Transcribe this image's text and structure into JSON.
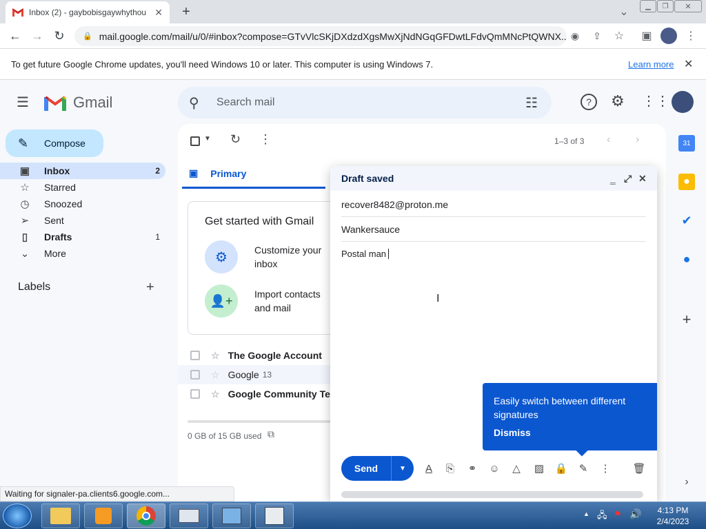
{
  "browser": {
    "tab_title": "Inbox (2) - gaybobisgaywhythou",
    "url": "mail.google.com/mail/u/0/#inbox?compose=GTvVlcSKjDXdzdXgsMwXjNdNGqGFDwtLFdvQmMNcPtQWNX...",
    "info_text": "To get future Google Chrome updates, you'll need Windows 10 or later. This computer is using Windows 7.",
    "learn_more": "Learn more",
    "status_text": "Waiting for signaler-pa.clients6.google.com..."
  },
  "gmail": {
    "logo_text": "Gmail",
    "search_placeholder": "Search mail",
    "compose_label": "Compose",
    "nav": [
      {
        "label": "Inbox",
        "count": "2"
      },
      {
        "label": "Starred",
        "count": ""
      },
      {
        "label": "Snoozed",
        "count": ""
      },
      {
        "label": "Sent",
        "count": ""
      },
      {
        "label": "Drafts",
        "count": "1"
      },
      {
        "label": "More",
        "count": ""
      }
    ],
    "labels_heading": "Labels",
    "pagination": "1–3 of 3",
    "tab_primary": "Primary",
    "get_started_title": "Get started with Gmail",
    "tasks": [
      {
        "line1": "Customize your",
        "line2": "inbox"
      },
      {
        "line1": "Import contacts",
        "line2": "and mail"
      }
    ],
    "emails": [
      {
        "sender": "The Google Account",
        "count": ""
      },
      {
        "sender": "Google",
        "count": "13"
      },
      {
        "sender": "Google Community Te",
        "count": ""
      }
    ],
    "storage": "0 GB of 15 GB used"
  },
  "compose": {
    "title": "Draft saved",
    "to": "recover8482@proton.me",
    "subject": "Wankersauce",
    "body": "Postal man",
    "tooltip_text": "Easily switch between different signatures",
    "tooltip_dismiss": "Dismiss",
    "send_label": "Send"
  },
  "taskbar": {
    "time": "4:13 PM",
    "date": "2/4/2023"
  },
  "colors": {
    "accent": "#0b57d0",
    "compose_bg": "#c2e7ff",
    "active_nav": "#d3e3fd",
    "gmail_red": "#ea4335"
  }
}
